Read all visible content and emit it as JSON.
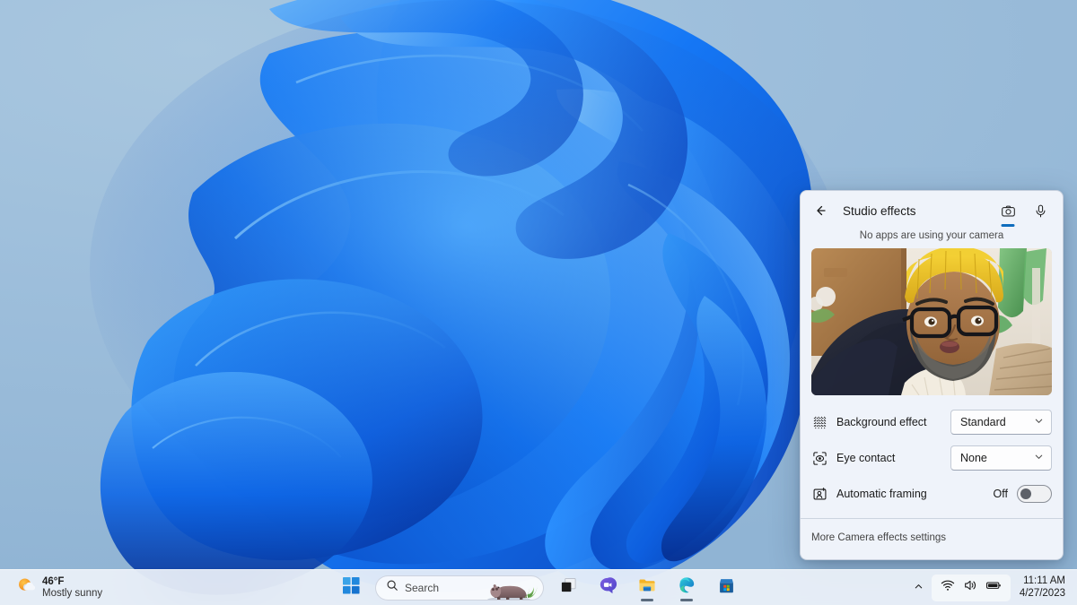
{
  "desktop": {
    "wallpaper_name": "windows-11-bloom-wallpaper",
    "bg_color": "#9fbfdc",
    "ribbon_colors": [
      "#0a6cf5",
      "#1e8cff",
      "#0b4fd4",
      "#3aa0ff",
      "#0741b0",
      "#56b4ff"
    ]
  },
  "flyout": {
    "title": "Studio effects",
    "back_icon": "back-arrow-icon",
    "tabs": [
      {
        "name": "camera",
        "icon": "camera-icon",
        "active": true
      },
      {
        "name": "microphone",
        "icon": "microphone-icon",
        "active": false
      }
    ],
    "status_text": "No apps are using your camera",
    "preview_alt": "camera-preview",
    "settings": [
      {
        "id": "background-effect",
        "icon": "background-blur-icon",
        "label": "Background effect",
        "control": "dropdown",
        "value": "Standard",
        "chevron": "chevron-down-icon"
      },
      {
        "id": "eye-contact",
        "icon": "eye-contact-icon",
        "label": "Eye contact",
        "control": "dropdown",
        "value": "None",
        "chevron": "chevron-down-icon"
      },
      {
        "id": "automatic-framing",
        "icon": "automatic-framing-icon",
        "label": "Automatic framing",
        "control": "toggle",
        "value": "Off",
        "toggle_on": false
      }
    ],
    "footer_link": "More Camera effects settings",
    "accent_color": "#0f6cbd"
  },
  "taskbar": {
    "weather": {
      "icon": "sun-behind-cloud-icon",
      "temperature": "46°F",
      "condition": "Mostly sunny"
    },
    "start": {
      "label": "Start",
      "icon": "windows-logo-icon"
    },
    "search": {
      "icon": "search-icon",
      "placeholder": "Search",
      "badge_icon": "hippo-image"
    },
    "apps": [
      {
        "name": "task-view",
        "icon": "task-view-icon",
        "running": false
      },
      {
        "name": "chat",
        "icon": "chat-teams-icon",
        "running": false
      },
      {
        "name": "file-explorer",
        "icon": "file-explorer-icon",
        "running": true
      },
      {
        "name": "microsoft-edge",
        "icon": "edge-icon",
        "running": true
      },
      {
        "name": "microsoft-store",
        "icon": "microsoft-store-icon",
        "running": false
      }
    ],
    "tray": {
      "overflow_icon": "chevron-up-icon",
      "icons": [
        "wifi-icon",
        "volume-icon",
        "battery-icon"
      ]
    },
    "clock": {
      "time": "11:11 AM",
      "date": "4/27/2023"
    }
  }
}
